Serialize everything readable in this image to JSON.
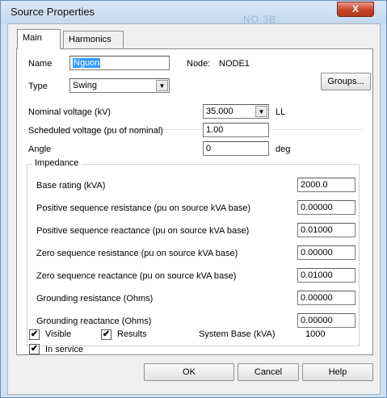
{
  "window": {
    "title": "Source Properties",
    "close_label": "X",
    "background_text": "NO 3B"
  },
  "tabs": [
    {
      "label": "Main"
    },
    {
      "label": "Harmonics"
    }
  ],
  "main": {
    "name": {
      "label": "Name",
      "value": "Nguon"
    },
    "node": {
      "label": "Node:",
      "value": "NODE1"
    },
    "groups_button": "Groups...",
    "type": {
      "label": "Type",
      "value": "Swing"
    },
    "nominal_voltage": {
      "label": "Nominal voltage (kV)",
      "value": "35.000",
      "unit": "LL"
    },
    "scheduled_voltage": {
      "label": "Scheduled voltage (pu of nominal)",
      "value": "1.00"
    },
    "angle": {
      "label": "Angle",
      "value": "0",
      "unit": "deg"
    }
  },
  "impedance": {
    "title": "Impedance",
    "rows": [
      {
        "label": "Base rating (kVA)",
        "value": "2000.0"
      },
      {
        "label": "Positive sequence resistance (pu on source kVA base)",
        "value": "0.00000"
      },
      {
        "label": "Positive sequence reactance (pu on source kVA base)",
        "value": "0.01000"
      },
      {
        "label": "Zero sequence resistance (pu on source kVA base)",
        "value": "0.00000"
      },
      {
        "label": "Zero sequence reactance (pu on source kVA base)",
        "value": "0.01000"
      },
      {
        "label": "Grounding resistance (Ohms)",
        "value": "0.00000"
      },
      {
        "label": "Grounding reactance (Ohms)",
        "value": "0.00000"
      }
    ]
  },
  "options": {
    "visible": {
      "label": "Visible",
      "checked": true
    },
    "results": {
      "label": "Results",
      "checked": true
    },
    "in_service": {
      "label": "In service",
      "checked": true
    },
    "system_base": {
      "label": "System Base (kVA)",
      "value": "1000"
    }
  },
  "buttons": {
    "ok": "OK",
    "cancel": "Cancel",
    "help": "Help"
  },
  "glyphs": {
    "check": "✔",
    "dropdown": "▼"
  }
}
